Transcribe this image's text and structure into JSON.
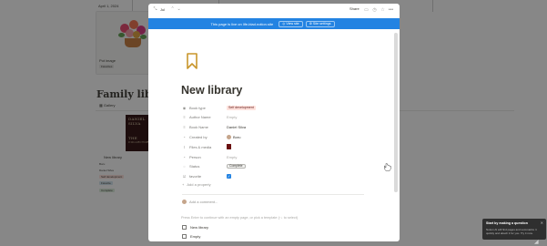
{
  "background": {
    "date": "April 1, 2024",
    "card_title": "Pot image",
    "card_tag": "Favorites",
    "section_title": "Family library",
    "gallery_label": "Gallery",
    "book_cover_lines": [
      "DANIEL",
      "SILVA",
      "",
      "THE",
      "COLLECTOR"
    ],
    "book_title": "New library",
    "book_meta": [
      "Boru",
      "Daniel Silva"
    ],
    "book_tags": [
      "Self development",
      "Favorite",
      "Complete"
    ]
  },
  "modal": {
    "toolbar": {
      "breadcrumb": "Jul",
      "share_label": "Share"
    },
    "banner": {
      "text": "This page is live on life-blad.notion.site",
      "view_site_label": "View site",
      "site_settings_label": "Site settings"
    },
    "page_title": "New library",
    "properties": [
      {
        "label": "Book type",
        "value": "Self development",
        "kind": "tag"
      },
      {
        "label": "Author Name",
        "value": "Empty",
        "kind": "empty"
      },
      {
        "label": "Book Name",
        "value": "Daniel Silva",
        "kind": "text"
      },
      {
        "label": "Created by",
        "value": "Boru",
        "kind": "person"
      },
      {
        "label": "Files & media",
        "value": "",
        "kind": "file"
      },
      {
        "label": "Person",
        "value": "Empty",
        "kind": "empty"
      },
      {
        "label": "Status",
        "value": "Complete",
        "kind": "status"
      },
      {
        "label": "favorite",
        "value": "",
        "kind": "checkbox",
        "checked": true
      }
    ],
    "add_property_label": "Add a property",
    "add_comment_label": "Add a comment...",
    "hint": "Press Enter to continue with an empty page, or pick a template (↑↓ to select)",
    "sub_items": [
      "New library",
      "Empty"
    ]
  },
  "toast": {
    "title": "Start by making a question",
    "body": "Notion AI will find pages and summarize it quickly and attach it for you. Try it now."
  },
  "colors": {
    "accent": "#2383e2",
    "tag_bg": "#ffe2dd",
    "icon_gold": "#c8962b"
  }
}
